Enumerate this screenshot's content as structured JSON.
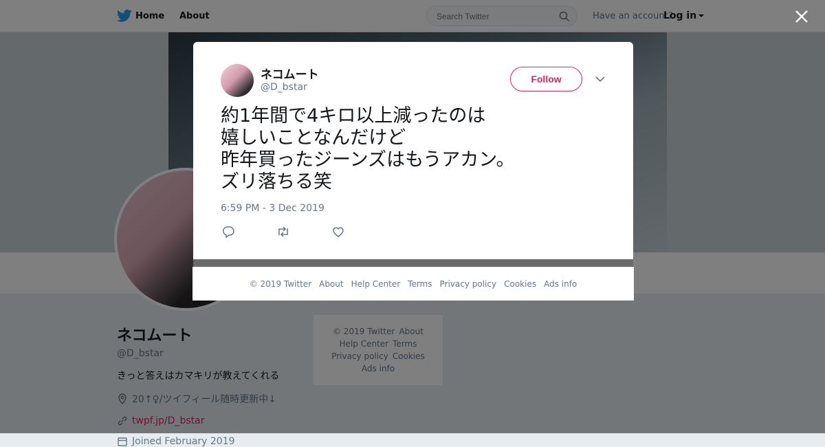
{
  "topbar": {
    "nav_home": "Home",
    "nav_about": "About",
    "search_placeholder": "Search Twitter",
    "have_account": "Have an account?",
    "login": "Log in"
  },
  "profile": {
    "name": "ネコムート",
    "handle": "@D_bstar",
    "bio": "きっと答えはカマキリが教えてくれる",
    "location": "20↑♀/ツイフィール随時更新中↓",
    "location_badge": "♀",
    "url": "twpf.jp/D_bstar",
    "joined": "Joined February 2019"
  },
  "side_footer": {
    "line1": [
      "© 2019 Twitter",
      "About"
    ],
    "line2": [
      "Help Center",
      "Terms"
    ],
    "line3": [
      "Privacy policy",
      "Cookies"
    ],
    "line4": [
      "Ads info"
    ]
  },
  "tweet": {
    "author_name": "ネコムート",
    "author_handle": "@D_bstar",
    "follow_label": "Follow",
    "lines": [
      "約1年間で4キロ以上減ったのは",
      "嬉しいことなんだけど",
      "昨年買ったジーンズはもうアカン。",
      "ズリ落ちる笑"
    ],
    "timestamp": "6:59 PM - 3 Dec 2019"
  },
  "modal_footer": [
    "© 2019 Twitter",
    "About",
    "Help Center",
    "Terms",
    "Privacy policy",
    "Cookies",
    "Ads info"
  ],
  "colors": {
    "accent": "#e0245e",
    "twitter_blue": "#1da1f2",
    "text": "#14171a",
    "muted": "#657786"
  },
  "icons": [
    "twitter-bird-icon",
    "search-icon",
    "caret-down-icon",
    "close-icon",
    "chevron-down-icon",
    "reply-icon",
    "retweet-icon",
    "like-icon",
    "location-icon",
    "link-icon",
    "calendar-icon"
  ]
}
